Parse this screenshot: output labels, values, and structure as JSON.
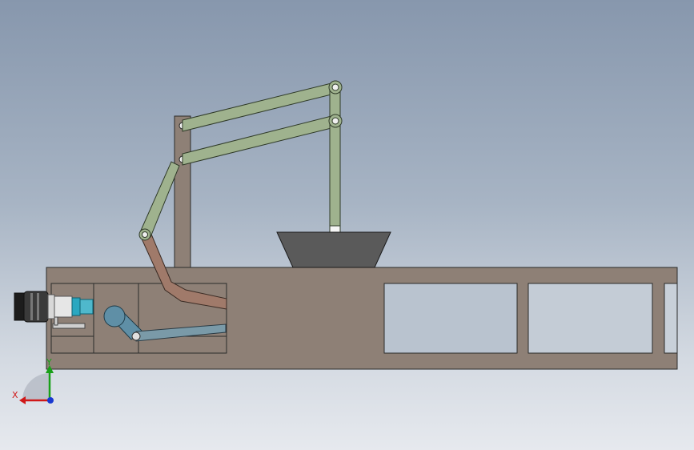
{
  "triad": {
    "x_label": "X",
    "y_label": "Y",
    "x_color": "#d01818",
    "y_color": "#18a018",
    "z_color": "#1838d0"
  },
  "colors": {
    "frame": "#8e8076",
    "link_green": "#9fb28e",
    "link_brown": "#a07a6a",
    "crank_blue": "#5f8fa6",
    "hopper": "#5a5a5a",
    "motor_dark": "#2a2a2a",
    "coupling_teal": "#2aa7c0"
  },
  "icons": [
    "triad-icon",
    "motor-icon"
  ]
}
